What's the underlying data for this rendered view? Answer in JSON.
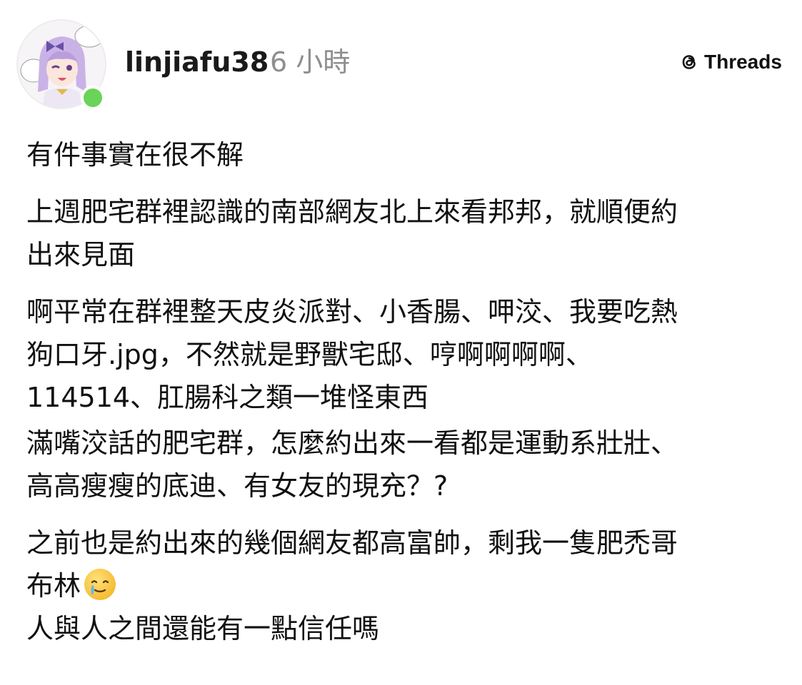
{
  "post_header": {
    "username": "linjiafu38",
    "timestamp": "6 小時",
    "brand": "Threads",
    "brand_icon": "threads-logo-icon",
    "online_color": "#69d35a"
  },
  "post_body": {
    "p1": [
      "有件事實在很不解"
    ],
    "p2": [
      "上週肥宅群裡認識的南部網友北上來看邦邦，就順便約",
      "出來見面"
    ],
    "p3": [
      "啊平常在群裡整天皮炎派對、小香腸、呷洨、我要吃熱",
      "狗口牙.jpg，不然就是野獸宅邸、哼啊啊啊啊、",
      "114514、肛腸科之類一堆怪東西"
    ],
    "p4": [
      "滿嘴洨話的肥宅群，怎麼約出來一看都是運動系壯壯、",
      "高高瘦瘦的底迪、有女友的現充？?"
    ],
    "p5": [
      "之前也是約出來的幾個網友都高富帥，剩我一隻肥禿哥",
      "布林"
    ],
    "p6": [
      "人與人之間還能有一點信任嗎"
    ],
    "emoji": "crying-smile-emoji"
  }
}
